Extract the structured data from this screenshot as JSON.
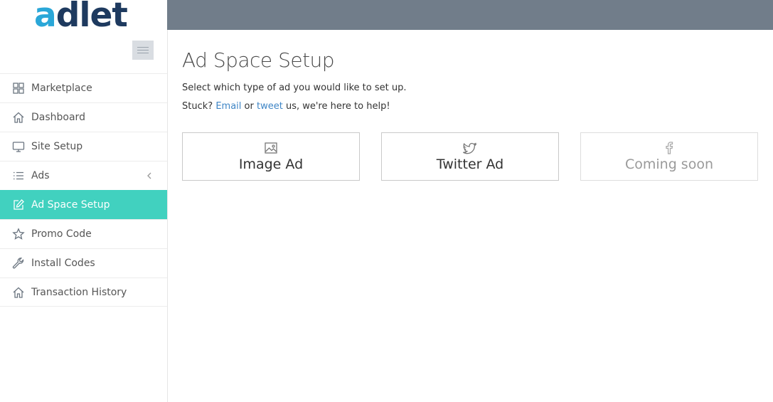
{
  "brand": {
    "logo_first": "a",
    "logo_rest": "dlet",
    "accent": "#41d1bf",
    "topbar_color": "#717d8a",
    "logo_color_a": "#2aa7d8",
    "logo_color_text": "#1e3a5f"
  },
  "sidebar": {
    "toggle_icon": "hamburger-menu-icon",
    "items": [
      {
        "label": "Marketplace",
        "icon": "grid-icon",
        "active": false
      },
      {
        "label": "Dashboard",
        "icon": "home-icon",
        "active": false
      },
      {
        "label": "Site Setup",
        "icon": "monitor-icon",
        "active": false
      },
      {
        "label": "Ads",
        "icon": "list-icon",
        "active": false,
        "expandable": true
      },
      {
        "label": "Ad Space Setup",
        "icon": "edit-icon",
        "active": true
      },
      {
        "label": "Promo Code",
        "icon": "star-icon",
        "active": false
      },
      {
        "label": "Install Codes",
        "icon": "wrench-icon",
        "active": false
      },
      {
        "label": "Transaction History",
        "icon": "home-icon",
        "active": false
      }
    ]
  },
  "main": {
    "title": "Ad Space Setup",
    "intro": "Select which type of ad you would like to set up.",
    "help": {
      "prefix": "Stuck?",
      "email_link": "Email",
      "or": "or",
      "tweet_link": "tweet",
      "suffix": "us, we're here to help!"
    },
    "options": [
      {
        "label": "Image Ad",
        "icon": "image-icon",
        "enabled": true
      },
      {
        "label": "Twitter Ad",
        "icon": "twitter-icon",
        "enabled": true
      },
      {
        "label": "Coming soon",
        "icon": "facebook-icon",
        "enabled": false
      }
    ]
  }
}
